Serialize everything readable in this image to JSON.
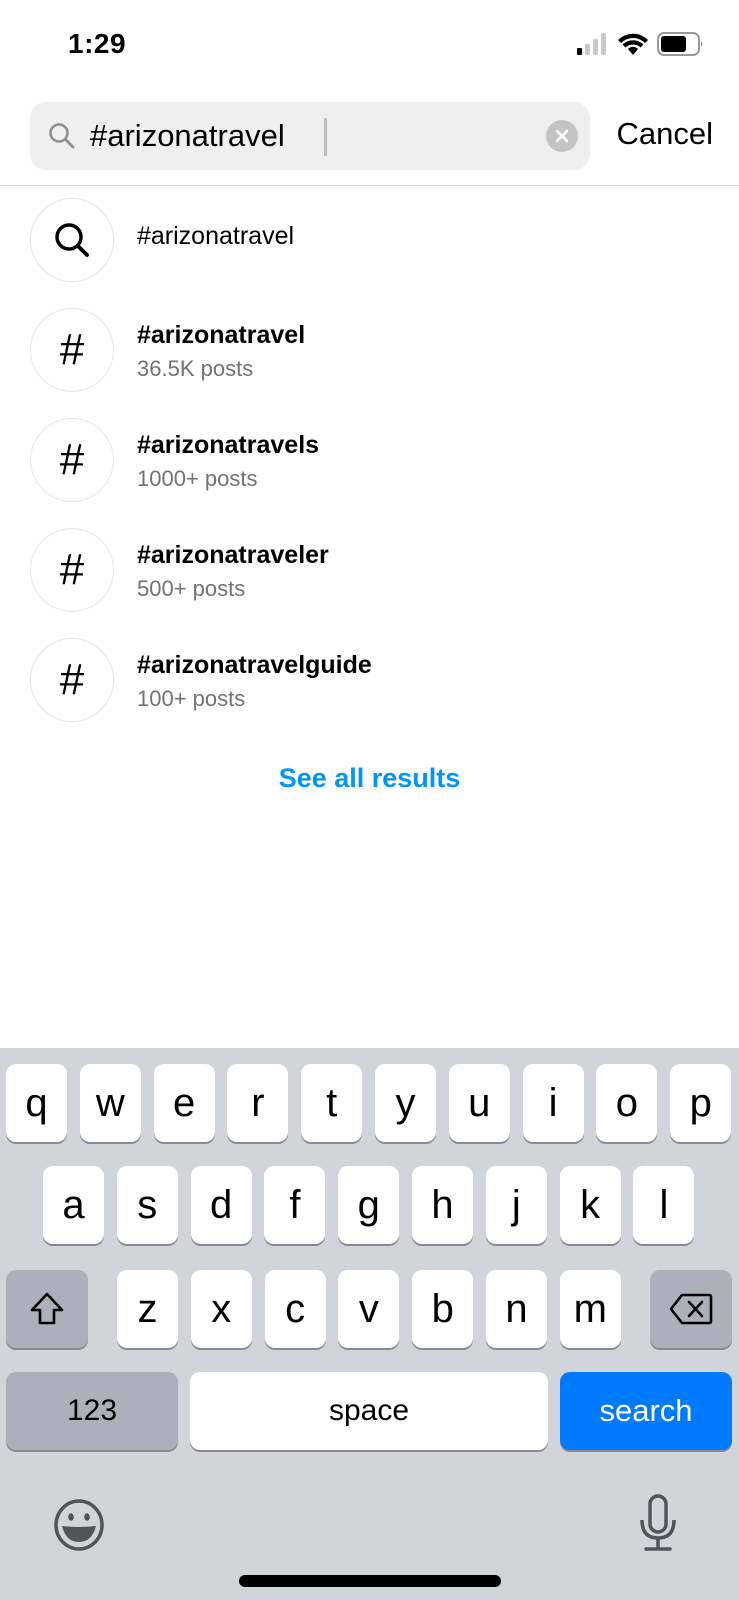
{
  "status_bar": {
    "time": "1:29",
    "icons": [
      "cellular-signal-icon",
      "wifi-icon",
      "battery-icon"
    ]
  },
  "search": {
    "value": "#arizonatravel",
    "placeholder": "Search",
    "clear_icon": "clear-icon",
    "cancel_label": "Cancel"
  },
  "results": [
    {
      "icon": "search-icon",
      "title": "#arizonatravel",
      "subtitle": ""
    },
    {
      "icon": "hashtag-icon",
      "title": "#arizonatravel",
      "subtitle": "36.5K posts"
    },
    {
      "icon": "hashtag-icon",
      "title": "#arizonatravels",
      "subtitle": "1000+ posts"
    },
    {
      "icon": "hashtag-icon",
      "title": "#arizonatraveler",
      "subtitle": "500+ posts"
    },
    {
      "icon": "hashtag-icon",
      "title": "#arizonatravelguide",
      "subtitle": "100+ posts"
    }
  ],
  "hash_glyph": "#",
  "see_all_label": "See all results",
  "colors": {
    "accent": "#0095f6",
    "keyboard_bg": "#d1d4db",
    "search_key": "#007aff"
  },
  "keyboard": {
    "row1": [
      "q",
      "w",
      "e",
      "r",
      "t",
      "y",
      "u",
      "i",
      "o",
      "p"
    ],
    "row2": [
      "a",
      "s",
      "d",
      "f",
      "g",
      "h",
      "j",
      "k",
      "l"
    ],
    "row3": [
      "z",
      "x",
      "c",
      "v",
      "b",
      "n",
      "m"
    ],
    "numbers_label": "123",
    "space_label": "space",
    "search_label": "search"
  }
}
